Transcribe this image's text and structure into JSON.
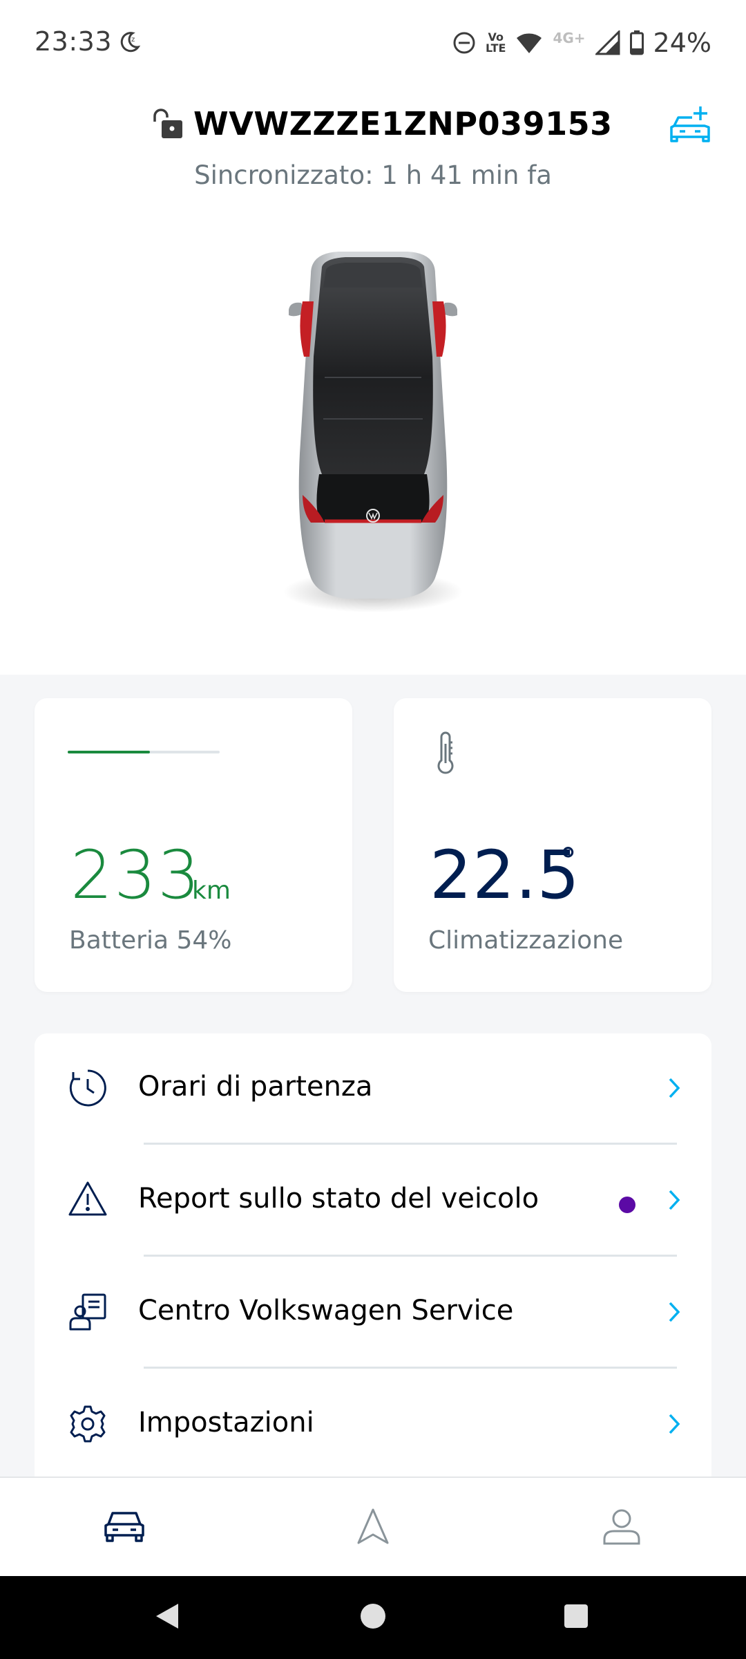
{
  "status_bar": {
    "time": "23:33",
    "battery": "24%",
    "network": "4G+",
    "volte": "Vo\nLTE"
  },
  "header": {
    "vin": "WVWZZZE1ZNP039153",
    "sync_status": "Sincronizzato: 1 h 41 min fa"
  },
  "battery_card": {
    "range_value": "233",
    "range_unit": "km",
    "label": "Batteria 54%",
    "charge_fraction": 0.54
  },
  "climate_card": {
    "temperature": "22.5",
    "degree_symbol": "°",
    "label": "Climatizzazione"
  },
  "menu": {
    "items": [
      {
        "label": "Orari di partenza",
        "icon": "clock-icon"
      },
      {
        "label": "Report sullo stato del veicolo",
        "icon": "warning-icon",
        "has_notification_dot": true
      },
      {
        "label": "Centro Volkswagen Service",
        "icon": "service-center-icon"
      },
      {
        "label": "Impostazioni",
        "icon": "gear-icon"
      }
    ]
  },
  "bottom_nav": {
    "tabs": [
      {
        "icon": "car-icon",
        "active": true
      },
      {
        "icon": "navigation-icon",
        "active": false
      },
      {
        "icon": "profile-icon",
        "active": false
      }
    ]
  },
  "colors": {
    "accent_blue": "#00b0f0",
    "navy": "#001e50",
    "range_green": "#1a8a3e",
    "notification_purple": "#5b0aa5",
    "muted_text": "#6a767d"
  }
}
